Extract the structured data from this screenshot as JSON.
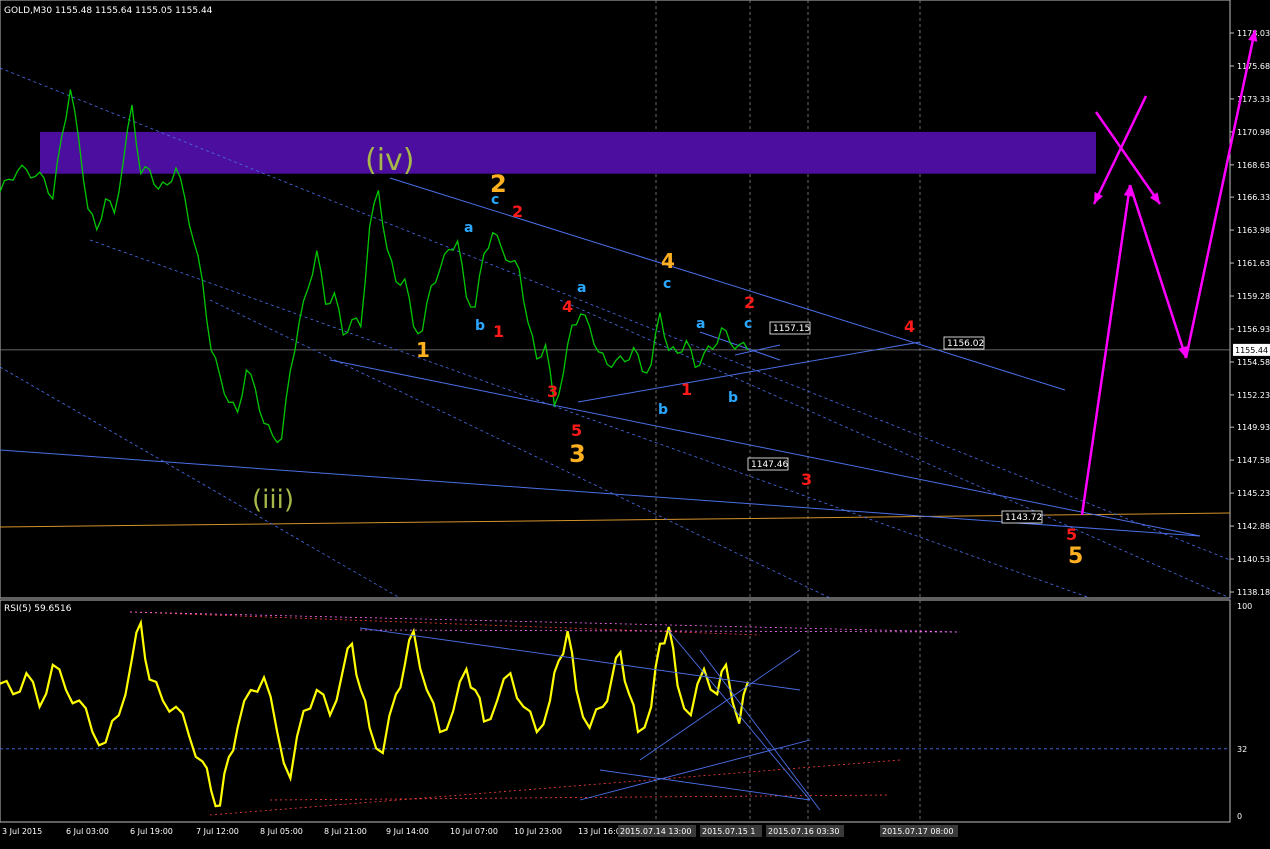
{
  "window": {
    "symbol_line": "GOLD,M30  1155.48 1155.64 1155.05 1155.44",
    "rsi_label": "RSI(5) 59.6516",
    "current_price": "1155.44"
  },
  "colors": {
    "background": "#000000",
    "price_line": "#00c800",
    "rsi_line": "#ffff00",
    "trend_line": "#4a6fe8",
    "zone": "#4b0e9e",
    "arrows": "#ff00ff",
    "support": "#d4932b",
    "label_red": "#ff1a1a",
    "label_orange": "#ffb020",
    "label_cyan": "#2aa8ff",
    "label_olive": "#a6b84a"
  },
  "chart_data": [
    {
      "type": "line",
      "title": "GOLD,M30",
      "series": [
        {
          "name": "GOLD,M30"
        }
      ],
      "ylim": [
        1138.18,
        1178.03
      ],
      "y_ticks": [
        "1178.03",
        "1175.68",
        "1173.33",
        "1170.98",
        "1168.63",
        "1166.33",
        "1163.98",
        "1161.63",
        "1159.28",
        "1156.93",
        "1154.58",
        "1152.23",
        "1149.93",
        "1147.58",
        "1145.23",
        "1142.88",
        "1140.53",
        "1138.18"
      ],
      "x_ticks": [
        "3 Jul 2015",
        "6 Jul 03:00",
        "6 Jul 19:00",
        "7 Jul 12:00",
        "8 Jul 05:00",
        "8 Jul 21:00",
        "9 Jul 14:00",
        "10 Jul 07:00",
        "10 Jul 23:00",
        "13 Jul 16:0"
      ],
      "x_tick_labels_highlighted": [
        "2015.07.14 13:00",
        "2015.07.15 1",
        "2015.07.16 03:30",
        "2015.07.17 08:00"
      ],
      "price_path": [
        [
          0,
          1166.7
        ],
        [
          2,
          1167.6
        ],
        [
          4,
          1168.2
        ],
        [
          6,
          1168.3
        ],
        [
          8,
          1167.8
        ],
        [
          10,
          1167.7
        ],
        [
          12,
          1166.2
        ],
        [
          14,
          1170.6
        ],
        [
          16,
          1174.0
        ],
        [
          18,
          1170.2
        ],
        [
          20,
          1165.5
        ],
        [
          22,
          1164.0
        ],
        [
          24,
          1166.2
        ],
        [
          26,
          1165.2
        ],
        [
          28,
          1168.8
        ],
        [
          30,
          1172.9
        ],
        [
          32,
          1168.0
        ],
        [
          34,
          1168.3
        ],
        [
          36,
          1166.9
        ],
        [
          38,
          1167.2
        ],
        [
          40,
          1168.4
        ],
        [
          42,
          1166.3
        ],
        [
          44,
          1163.2
        ],
        [
          46,
          1160.4
        ],
        [
          48,
          1155.4
        ],
        [
          50,
          1153.6
        ],
        [
          52,
          1151.7
        ],
        [
          54,
          1151.0
        ],
        [
          56,
          1154.0
        ],
        [
          58,
          1152.7
        ],
        [
          60,
          1150.2
        ],
        [
          62,
          1149.3
        ],
        [
          64,
          1149.1
        ],
        [
          66,
          1154.0
        ],
        [
          68,
          1157.4
        ],
        [
          70,
          1159.8
        ],
        [
          72,
          1162.5
        ],
        [
          74,
          1158.7
        ],
        [
          76,
          1159.5
        ],
        [
          78,
          1156.5
        ],
        [
          80,
          1157.6
        ],
        [
          82,
          1157.1
        ],
        [
          84,
          1164.2
        ],
        [
          86,
          1166.8
        ],
        [
          88,
          1162.6
        ],
        [
          90,
          1160.3
        ],
        [
          92,
          1160.5
        ],
        [
          94,
          1157.1
        ],
        [
          96,
          1156.8
        ],
        [
          98,
          1160.0
        ],
        [
          100,
          1161.2
        ],
        [
          102,
          1162.6
        ],
        [
          104,
          1163.2
        ],
        [
          106,
          1159.2
        ],
        [
          108,
          1158.5
        ],
        [
          110,
          1162.3
        ],
        [
          112,
          1163.8
        ],
        [
          114,
          1162.7
        ],
        [
          116,
          1161.7
        ],
        [
          118,
          1161.2
        ],
        [
          120,
          1157.4
        ],
        [
          122,
          1154.8
        ],
        [
          124,
          1155.8
        ],
        [
          126,
          1151.5
        ],
        [
          128,
          1153.7
        ],
        [
          130,
          1157.2
        ],
        [
          132,
          1158.0
        ],
        [
          134,
          1157.1
        ],
        [
          136,
          1155.3
        ],
        [
          138,
          1154.4
        ],
        [
          140,
          1154.7
        ],
        [
          142,
          1154.6
        ],
        [
          144,
          1155.6
        ],
        [
          146,
          1153.9
        ],
        [
          148,
          1154.4
        ],
        [
          150,
          1158.1
        ],
        [
          152,
          1155.4
        ],
        [
          154,
          1155.2
        ],
        [
          156,
          1156.1
        ],
        [
          158,
          1154.2
        ],
        [
          160,
          1155.2
        ],
        [
          162,
          1155.5
        ],
        [
          164,
          1157.0
        ],
        [
          166,
          1155.9
        ],
        [
          168,
          1155.8
        ],
        [
          170,
          1155.44
        ]
      ],
      "annotations": {
        "wave_labels": [
          {
            "text": "(iv)",
            "color": "olive"
          },
          {
            "text": "(iii)",
            "color": "olive"
          },
          {
            "text": "2",
            "color": "orange"
          },
          {
            "text": "1",
            "color": "orange"
          },
          {
            "text": "3",
            "color": "orange"
          },
          {
            "text": "4",
            "color": "orange"
          },
          {
            "text": "5",
            "color": "orange"
          },
          {
            "text": "2",
            "color": "red"
          },
          {
            "text": "1",
            "color": "red"
          },
          {
            "text": "4",
            "color": "red"
          },
          {
            "text": "3",
            "color": "red"
          },
          {
            "text": "5",
            "color": "red"
          },
          {
            "text": "1",
            "color": "red"
          },
          {
            "text": "2",
            "color": "red"
          },
          {
            "text": "4",
            "color": "red"
          },
          {
            "text": "3",
            "color": "red"
          },
          {
            "text": "5",
            "color": "red"
          },
          {
            "text": "c",
            "color": "cyan"
          },
          {
            "text": "a",
            "color": "cyan"
          },
          {
            "text": "b",
            "color": "cyan"
          },
          {
            "text": "a",
            "color": "cyan"
          },
          {
            "text": "c",
            "color": "cyan"
          },
          {
            "text": "b",
            "color": "cyan"
          },
          {
            "text": "a",
            "color": "cyan"
          },
          {
            "text": "c",
            "color": "cyan"
          },
          {
            "text": "b",
            "color": "cyan"
          }
        ],
        "price_tags": [
          "1157.15",
          "1156.02",
          "1147.46",
          "1143.72"
        ]
      }
    },
    {
      "type": "line",
      "title": "RSI(5) 59.6516",
      "series": [
        {
          "name": "RSI(5)"
        }
      ],
      "ylim": [
        0,
        100
      ],
      "y_ticks": [
        "100",
        "32",
        "0"
      ],
      "rsi_path": [
        [
          0,
          63
        ],
        [
          3,
          58
        ],
        [
          6,
          68
        ],
        [
          9,
          52
        ],
        [
          12,
          72
        ],
        [
          15,
          60
        ],
        [
          18,
          55
        ],
        [
          21,
          40
        ],
        [
          24,
          35
        ],
        [
          27,
          48
        ],
        [
          30,
          75
        ],
        [
          32,
          92
        ],
        [
          34,
          65
        ],
        [
          37,
          55
        ],
        [
          40,
          52
        ],
        [
          43,
          38
        ],
        [
          46,
          26
        ],
        [
          48,
          12
        ],
        [
          50,
          5
        ],
        [
          52,
          28
        ],
        [
          54,
          42
        ],
        [
          57,
          60
        ],
        [
          60,
          66
        ],
        [
          63,
          40
        ],
        [
          66,
          18
        ],
        [
          69,
          50
        ],
        [
          72,
          60
        ],
        [
          75,
          48
        ],
        [
          78,
          70
        ],
        [
          80,
          82
        ],
        [
          82,
          60
        ],
        [
          84,
          42
        ],
        [
          87,
          30
        ],
        [
          90,
          58
        ],
        [
          92,
          72
        ],
        [
          94,
          88
        ],
        [
          97,
          60
        ],
        [
          100,
          40
        ],
        [
          103,
          50
        ],
        [
          106,
          70
        ],
        [
          108,
          60
        ],
        [
          110,
          45
        ],
        [
          113,
          55
        ],
        [
          116,
          68
        ],
        [
          119,
          52
        ],
        [
          122,
          40
        ],
        [
          125,
          55
        ],
        [
          127,
          74
        ],
        [
          129,
          88
        ],
        [
          131,
          60
        ],
        [
          134,
          42
        ],
        [
          137,
          52
        ],
        [
          139,
          65
        ],
        [
          141,
          78
        ],
        [
          143,
          58
        ],
        [
          145,
          40
        ],
        [
          148,
          52
        ],
        [
          150,
          82
        ],
        [
          152,
          90
        ],
        [
          154,
          62
        ],
        [
          157,
          48
        ],
        [
          160,
          70
        ],
        [
          163,
          58
        ],
        [
          165,
          72
        ],
        [
          168,
          44
        ],
        [
          170,
          64
        ]
      ]
    }
  ]
}
